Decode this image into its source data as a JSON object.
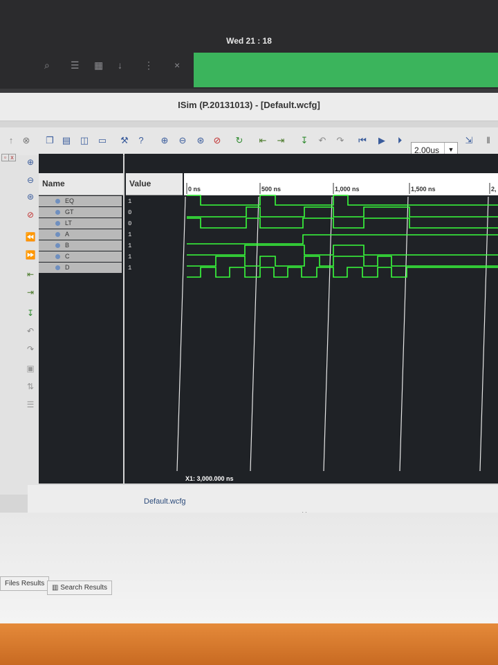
{
  "system": {
    "clock": "Wed 21 : 18",
    "close_glyph": "×"
  },
  "window": {
    "title": "ISim (P.20131013) - [Default.wcfg]"
  },
  "toolbar": {
    "zoom_value": "2.00us"
  },
  "name_column": {
    "header": "Name"
  },
  "value_column": {
    "header": "Value"
  },
  "signals": [
    {
      "name": "EQ",
      "value": "1"
    },
    {
      "name": "GT",
      "value": "0"
    },
    {
      "name": "LT",
      "value": "0"
    },
    {
      "name": "A",
      "value": "1"
    },
    {
      "name": "B",
      "value": "1"
    },
    {
      "name": "C",
      "value": "1"
    },
    {
      "name": "D",
      "value": "1"
    }
  ],
  "timeline": {
    "ticks": [
      "0 ns",
      "500 ns",
      "1,000 ns",
      "1,500 ns",
      "2,"
    ]
  },
  "cursor": {
    "readout": "X1: 3,000.000 ns"
  },
  "tabs": {
    "document": "Default.wcfg",
    "close": "×"
  },
  "bottom_tabs": [
    "Files Results",
    "Search Results"
  ],
  "colors": {
    "waveform": "#39ff3c",
    "pane_bg": "#1f2226",
    "accent": "#3bb45c"
  }
}
